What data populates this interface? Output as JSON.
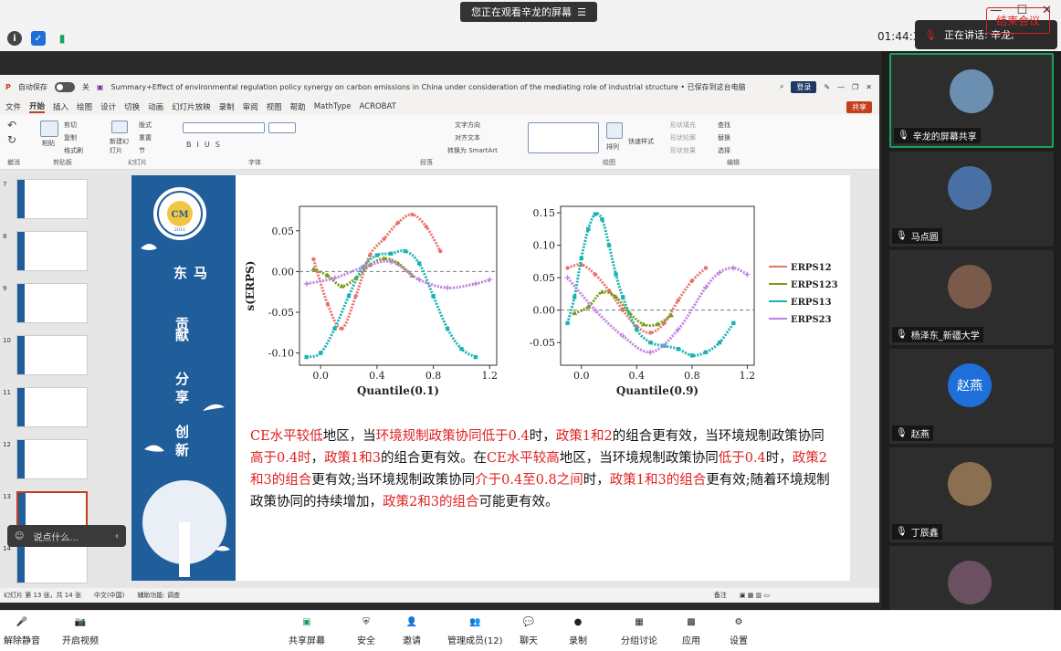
{
  "meeting": {
    "banner": "您正在观看辛龙的屏幕",
    "timer": "01:44:3",
    "speaking": "正在讲话: 辛龙;",
    "end_button": "结束会议"
  },
  "ppt": {
    "autosave": "自动保存",
    "autosave_state": "关",
    "title": "Summary+Effect of environmental regulation policy synergy on carbon emissions in China under consideration of the mediating role of industrial structure • 已保存到这台电脑",
    "login": "登录",
    "menu": [
      "文件",
      "开始",
      "插入",
      "绘图",
      "设计",
      "切换",
      "动画",
      "幻灯片放映",
      "录制",
      "审阅",
      "视图",
      "帮助",
      "MathType",
      "ACROBAT"
    ],
    "menu_selected": "开始",
    "share": "共享",
    "ribbon_groups": [
      "撤消",
      "剪贴板",
      "幻灯片",
      "字体",
      "段落",
      "绘图",
      "编辑"
    ],
    "ribbon_buttons": {
      "paste": "粘贴",
      "cut": "剪切",
      "copy": "复制",
      "format": "格式刷",
      "new_slide": "新建幻灯片",
      "layout": "版式",
      "reset": "重置",
      "section": "节",
      "find": "查找",
      "replace": "替换",
      "select": "选择",
      "arrange": "排列",
      "quick_style": "快速样式",
      "text_dir": "文字方向",
      "align": "对齐文本",
      "smartart": "转换为 SmartArt",
      "fill": "形状填充",
      "outline": "形状轮廓",
      "effect": "形状效果"
    },
    "status_left": "幻灯片 第 13 张，共 14 张",
    "status_lang": "中文(中国)",
    "status_access": "辅助功能: 调查",
    "status_notes": "备注",
    "thumbs": [
      7,
      8,
      9,
      10,
      11,
      12,
      13,
      14
    ],
    "selected_thumb": 13
  },
  "slide": {
    "calligraphy": [
      "东",
      "马",
      "贡",
      "献",
      "分",
      "享",
      "创",
      "新"
    ],
    "logo_year": "2011",
    "paragraph": [
      {
        "t": "CE水平较低",
        "r": true
      },
      {
        "t": "地区，当",
        "r": false
      },
      {
        "t": "环境规制政策协同低于0.4",
        "r": true
      },
      {
        "t": "时，",
        "r": false
      },
      {
        "t": "政策1和2",
        "r": true
      },
      {
        "t": "的组合更有效，当环境规制政策协同",
        "r": false
      },
      {
        "t": "高于0.4时",
        "r": true
      },
      {
        "t": "，",
        "r": false
      },
      {
        "t": "政策1和3",
        "r": true
      },
      {
        "t": "的组合更有效。在",
        "r": false
      },
      {
        "t": "CE水平较高",
        "r": true
      },
      {
        "t": "地区，当环境规制政策协同",
        "r": false
      },
      {
        "t": "低于0.4",
        "r": true
      },
      {
        "t": "时，",
        "r": false
      },
      {
        "t": "政策2和3的组合",
        "r": true
      },
      {
        "t": "更有效;当环境规制政策协同",
        "r": false
      },
      {
        "t": "介于0.4至0.8之间",
        "r": true
      },
      {
        "t": "时，",
        "r": false
      },
      {
        "t": "政策1和3的组合",
        "r": true
      },
      {
        "t": "更有效;随着环境规制政策协同的持续增加，",
        "r": false
      },
      {
        "t": "政策2和3的组合",
        "r": true
      },
      {
        "t": "可能更有效。",
        "r": false
      }
    ]
  },
  "chat_placeholder": "说点什么...",
  "participants": [
    {
      "name": "辛龙的屏幕共享",
      "active": true,
      "color": "#6a8fb0"
    },
    {
      "name": "马点圆",
      "active": false,
      "color": "#4a6fa5"
    },
    {
      "name": "杨泽东_新疆大学",
      "active": false,
      "color": "#7a5a4a"
    },
    {
      "name": "赵燕",
      "active": false,
      "color": "#1e6fd9",
      "initials": "赵燕"
    },
    {
      "name": "丁辰鑫",
      "active": false,
      "color": "#8a7050"
    },
    {
      "name": "",
      "active": false,
      "color": "#6a5060"
    }
  ],
  "toolbar": {
    "items": [
      "解除静音",
      "开启视频",
      "共享屏幕",
      "安全",
      "邀请",
      "管理成员(12)",
      "聊天",
      "录制",
      "分组讨论",
      "应用",
      "设置"
    ]
  },
  "colors": {
    "erps12": "#e8736c",
    "erps123": "#7a9a1a",
    "erps13": "#1ab3b3",
    "erps23": "#c080e0",
    "slide_blue": "#1f5d9b",
    "accent_red": "#e02020"
  },
  "chart_data": [
    {
      "type": "line",
      "title": "",
      "xlabel": "Quantile(0.1)",
      "ylabel": "s(ERPS)",
      "xlim": [
        -0.15,
        1.25
      ],
      "ylim": [
        -0.115,
        0.08
      ],
      "xticks": [
        0.0,
        0.4,
        0.8,
        1.2
      ],
      "xtick_labels": [
        "0.0",
        "0.4",
        "0.8",
        "1.2"
      ],
      "yticks": [
        0.05,
        0.0,
        -0.05,
        -0.1
      ],
      "ytick_labels": [
        "0.05",
        "0.00",
        "-0.05",
        "-0.10"
      ],
      "series": [
        {
          "name": "ERPS12",
          "x": [
            -0.05,
            0.05,
            0.15,
            0.25,
            0.35,
            0.45,
            0.55,
            0.65,
            0.75,
            0.85
          ],
          "y": [
            0.015,
            -0.04,
            -0.07,
            -0.03,
            0.02,
            0.04,
            0.06,
            0.07,
            0.055,
            0.025
          ]
        },
        {
          "name": "ERPS123",
          "x": [
            -0.05,
            0.05,
            0.15,
            0.25,
            0.35,
            0.45,
            0.55,
            0.65
          ],
          "y": [
            0.003,
            -0.005,
            -0.018,
            -0.008,
            0.008,
            0.016,
            0.01,
            -0.005
          ]
        },
        {
          "name": "ERPS13",
          "x": [
            -0.1,
            0.0,
            0.1,
            0.2,
            0.3,
            0.4,
            0.5,
            0.6,
            0.7,
            0.8,
            0.9,
            1.0,
            1.1
          ],
          "y": [
            -0.105,
            -0.1,
            -0.07,
            -0.03,
            0.005,
            0.02,
            0.022,
            0.025,
            0.01,
            -0.03,
            -0.07,
            -0.095,
            -0.105
          ]
        },
        {
          "name": "ERPS23",
          "x": [
            -0.1,
            0.1,
            0.3,
            0.5,
            0.7,
            0.9,
            1.1,
            1.2
          ],
          "y": [
            -0.015,
            -0.008,
            0.005,
            0.012,
            -0.01,
            -0.02,
            -0.015,
            -0.01
          ]
        }
      ]
    },
    {
      "type": "line",
      "title": "",
      "xlabel": "Quantile(0.9)",
      "ylabel": "",
      "xlim": [
        -0.15,
        1.25
      ],
      "ylim": [
        -0.085,
        0.16
      ],
      "xticks": [
        0.0,
        0.4,
        0.8,
        1.2
      ],
      "xtick_labels": [
        "0.0",
        "0.4",
        "0.8",
        "1.2"
      ],
      "yticks": [
        0.15,
        0.1,
        0.05,
        0.0,
        -0.05
      ],
      "ytick_labels": [
        "0.15",
        "0.10",
        "0.05",
        "0.00",
        "-0.05"
      ],
      "series": [
        {
          "name": "ERPS12",
          "x": [
            -0.1,
            0.0,
            0.1,
            0.2,
            0.3,
            0.4,
            0.5,
            0.6,
            0.7,
            0.8,
            0.9
          ],
          "y": [
            0.065,
            0.07,
            0.055,
            0.03,
            0.0,
            -0.025,
            -0.035,
            -0.02,
            0.015,
            0.045,
            0.065
          ]
        },
        {
          "name": "ERPS123",
          "x": [
            -0.05,
            0.05,
            0.15,
            0.25,
            0.35,
            0.45,
            0.55,
            0.65
          ],
          "y": [
            -0.005,
            0.005,
            0.028,
            0.02,
            -0.005,
            -0.022,
            -0.022,
            -0.008
          ]
        },
        {
          "name": "ERPS13",
          "x": [
            -0.1,
            -0.05,
            0.0,
            0.05,
            0.1,
            0.15,
            0.2,
            0.25,
            0.3,
            0.4,
            0.5,
            0.6,
            0.7,
            0.8,
            0.9,
            1.0,
            1.1
          ],
          "y": [
            -0.02,
            0.02,
            0.08,
            0.125,
            0.148,
            0.14,
            0.1,
            0.055,
            0.02,
            -0.03,
            -0.05,
            -0.055,
            -0.06,
            -0.07,
            -0.065,
            -0.05,
            -0.02
          ]
        },
        {
          "name": "ERPS23",
          "x": [
            -0.1,
            0.1,
            0.3,
            0.5,
            0.7,
            0.9,
            1.0,
            1.1,
            1.2
          ],
          "y": [
            0.05,
            0.0,
            -0.04,
            -0.065,
            -0.03,
            0.035,
            0.058,
            0.065,
            0.055
          ]
        }
      ]
    }
  ]
}
